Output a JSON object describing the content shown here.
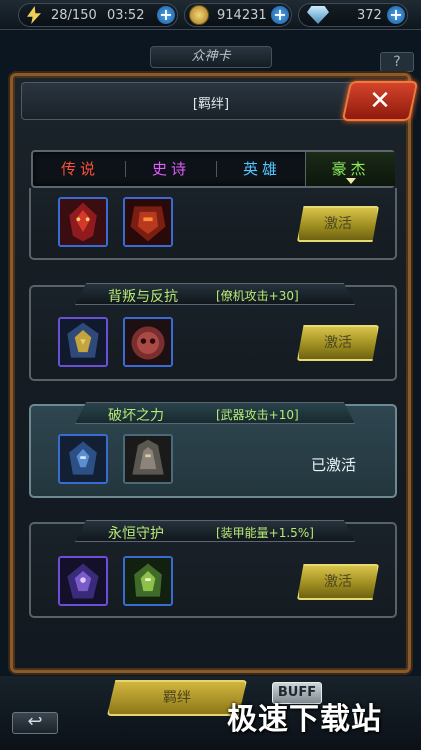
{
  "top_bar": {
    "stamina": "28/150",
    "timer": "03:52",
    "gold": "914231",
    "diamonds": "372"
  },
  "background": {
    "deck_title": "众神卡",
    "help_label": "?"
  },
  "dialog": {
    "title": "[羁绊]",
    "close_label": "✕",
    "tabs": [
      {
        "label": "传说",
        "color": "#ff4f38"
      },
      {
        "label": "史诗",
        "color": "#e35cff"
      },
      {
        "label": "英雄",
        "color": "#54c6ff"
      },
      {
        "label": "豪杰",
        "color": "#8df05a",
        "active": true
      }
    ],
    "bonds": [
      {
        "name": "",
        "bonus": "",
        "state": "activate",
        "button_label": "激活"
      },
      {
        "name": "背叛与反抗",
        "bonus": "[僚机攻击+30]",
        "state": "activate",
        "button_label": "激活"
      },
      {
        "name": "破坏之力",
        "bonus": "[武器攻击+10]",
        "state": "activated",
        "status_label": "已激活"
      },
      {
        "name": "永恒守护",
        "bonus": "[装甲能量+1.5%]",
        "state": "activate",
        "button_label": "激活"
      }
    ]
  },
  "bottom": {
    "bond_button": "羁绊",
    "buff_button": "BUFF",
    "back_button": "↩"
  },
  "watermark": "极速下载站",
  "colors": {
    "accent_gold": "#d1b53f",
    "bond_text": "#b7ea74",
    "close_red": "#d4442a"
  }
}
